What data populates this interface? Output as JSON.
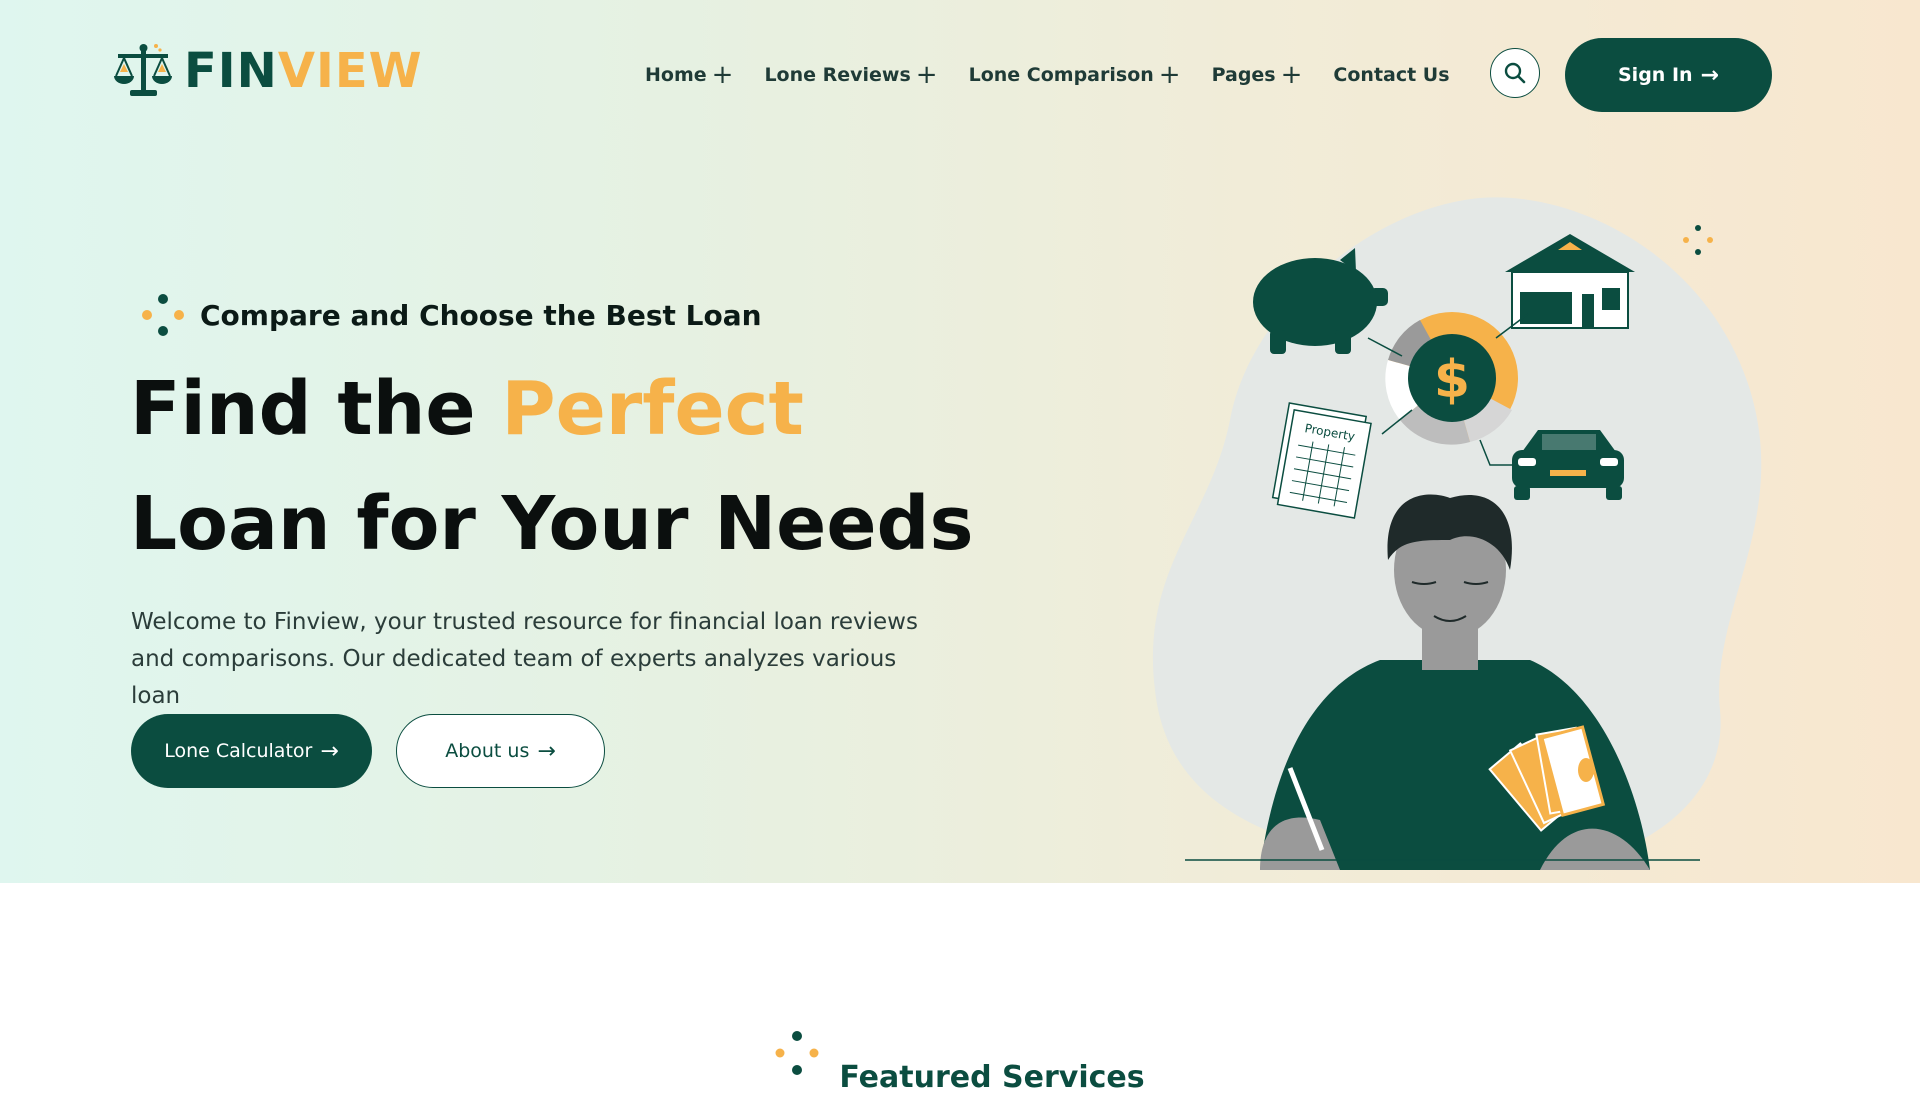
{
  "brand": {
    "name_part1": "FIN",
    "name_part2": "VIEW",
    "colors": {
      "primary": "#0b4d40",
      "accent": "#f6b24a"
    }
  },
  "nav": {
    "items": [
      {
        "label": "Home",
        "has_submenu": true
      },
      {
        "label": "Lone Reviews",
        "has_submenu": true
      },
      {
        "label": "Lone Comparison",
        "has_submenu": true
      },
      {
        "label": "Pages",
        "has_submenu": true
      },
      {
        "label": "Contact Us",
        "has_submenu": false
      }
    ],
    "submenu_icon": "+",
    "search_icon": "search-icon",
    "signin_label": "Sign In",
    "signin_icon": "→"
  },
  "hero": {
    "tagline": "Compare and Choose the Best Loan",
    "headline_before": "Find the ",
    "headline_accent": "Perfect",
    "headline_after": " Loan for Your Needs",
    "lead": "Welcome to Finview, your trusted resource for financial loan reviews and comparisons. Our dedicated team of experts analyzes various loan",
    "primary_button": "Lone Calculator",
    "secondary_button": "About us",
    "button_icon": "→",
    "illustration_label": "Property"
  },
  "featured": {
    "title": "Featured Services"
  }
}
